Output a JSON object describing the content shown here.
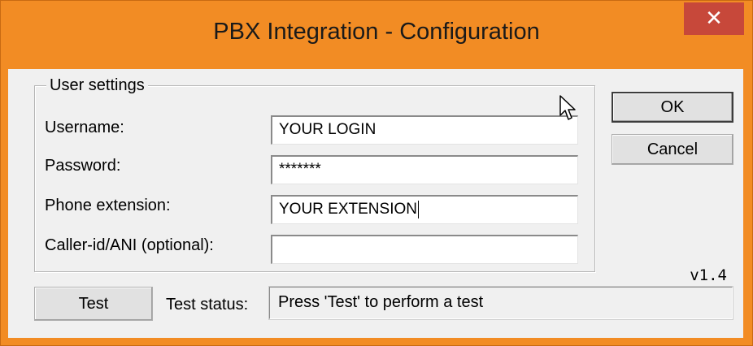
{
  "window": {
    "title": "PBX Integration - Configuration",
    "close_icon": "close-x-icon",
    "accent_color": "#f28c24",
    "close_color": "#c7483a"
  },
  "user_settings": {
    "group_label": "User settings",
    "username_label": "Username:",
    "username_value": "YOUR LOGIN",
    "password_label": "Password:",
    "password_value": "*******",
    "extension_label": "Phone extension:",
    "extension_value": "YOUR EXTENSION",
    "callerid_label": "Caller-id/ANI (optional):",
    "callerid_value": ""
  },
  "buttons": {
    "ok": "OK",
    "cancel": "Cancel",
    "test": "Test"
  },
  "version": "v1.4",
  "status": {
    "label": "Test status:",
    "text": "Press 'Test' to perform a test"
  },
  "icons": {
    "mouse_cursor": "mouse-pointer-icon"
  }
}
